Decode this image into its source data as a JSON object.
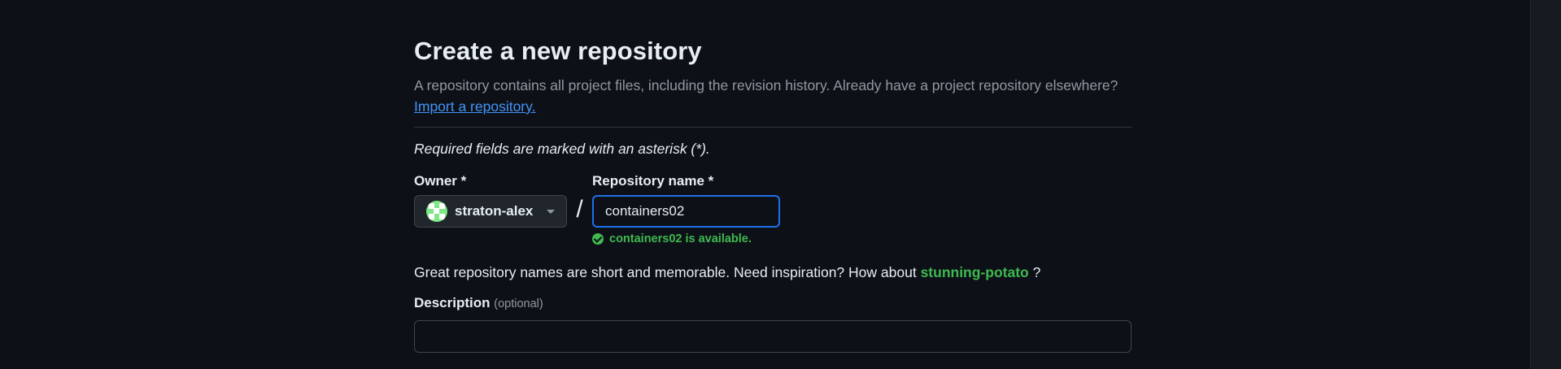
{
  "header": {
    "title": "Create a new repository",
    "subtitle": "A repository contains all project files, including the revision history. Already have a project repository elsewhere?",
    "import_link": "Import a repository."
  },
  "form": {
    "required_note": "Required fields are marked with an asterisk (*).",
    "owner": {
      "label": "Owner *",
      "selected": "straton-alex"
    },
    "separator": "/",
    "repository_name": {
      "label": "Repository name *",
      "value": "containers02",
      "availability": "containers02 is available."
    },
    "suggestion": {
      "prefix": "Great repository names are short and memorable. Need inspiration? How about",
      "name": "stunning-potato",
      "suffix": "?"
    },
    "description": {
      "label": "Description",
      "optional": "(optional)",
      "value": ""
    }
  },
  "colors": {
    "background": "#0d1117",
    "link": "#4493f8",
    "success": "#3fb950",
    "focus_border": "#1f6feb"
  }
}
